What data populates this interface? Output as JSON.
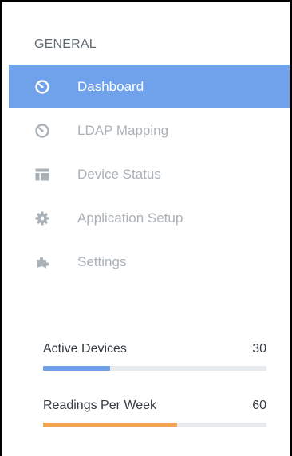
{
  "sidebar": {
    "section_title": "GENERAL",
    "items": [
      {
        "label": "Dashboard",
        "icon": "dashboard-gauge-icon",
        "active": true
      },
      {
        "label": "LDAP Mapping",
        "icon": "gauge-icon",
        "active": false
      },
      {
        "label": "Device Status",
        "icon": "table-icon",
        "active": false
      },
      {
        "label": "Application Setup",
        "icon": "gear-icon",
        "active": false
      },
      {
        "label": "Settings",
        "icon": "puzzle-icon",
        "active": false
      }
    ]
  },
  "stats": [
    {
      "label": "Active Devices",
      "value": "30",
      "progress": 0.3,
      "color": "#6fa2ea"
    },
    {
      "label": "Readings Per Week",
      "value": "60",
      "progress": 0.6,
      "color": "#efa552"
    }
  ],
  "colors": {
    "accent": "#6fa2ea",
    "inactive_text": "#aab2b8",
    "section_title": "#5f6b73",
    "stat_text": "#333b40",
    "track": "#e8ebee"
  }
}
